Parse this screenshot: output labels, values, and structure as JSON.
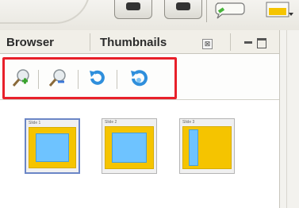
{
  "panel": {
    "tabs": [
      {
        "label": "Browser"
      },
      {
        "label": "Thumbnails"
      }
    ],
    "close_glyph": "⊠"
  },
  "tools": [
    {
      "icon": "zoom-in-icon"
    },
    {
      "icon": "zoom-out-icon"
    },
    {
      "icon": "rotate-left-icon"
    },
    {
      "icon": "rotate-right-icon"
    }
  ],
  "thumbnails": [
    {
      "caption": "Slide 1",
      "selected": true
    },
    {
      "caption": "Slide 2",
      "selected": false
    },
    {
      "caption": "Slide 3",
      "selected": false
    }
  ],
  "colors": {
    "highlight": "#e8202a",
    "slide_bg": "#f5c400",
    "slide_shape": "#6ec3ff"
  }
}
